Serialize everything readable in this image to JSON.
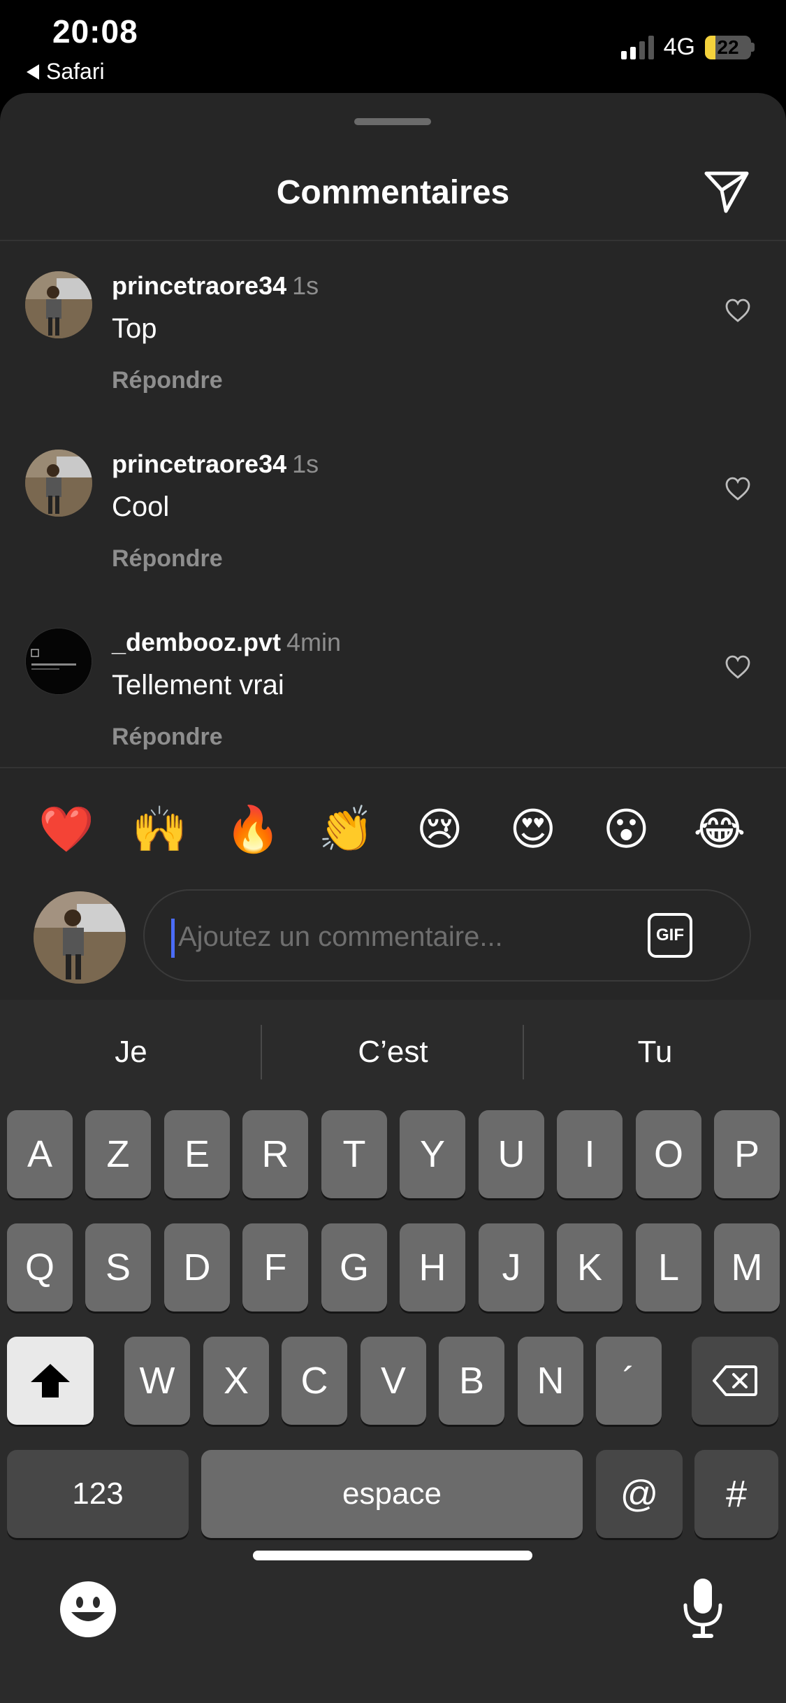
{
  "status": {
    "time": "20:08",
    "back_app": "Safari",
    "network": "4G",
    "battery": "22"
  },
  "sheet": {
    "title": "Commentaires"
  },
  "comments": [
    {
      "username": "princetraore34",
      "time": "1s",
      "text": "Top",
      "reply": "Répondre"
    },
    {
      "username": "princetraore34",
      "time": "1s",
      "text": "Cool",
      "reply": "Répondre"
    },
    {
      "username": "_dembooz.pvt",
      "time": "4min",
      "text": "Tellement vrai",
      "reply": "Répondre"
    }
  ],
  "reactions": [
    "❤️",
    "🙌",
    "🔥",
    "👏",
    "😢",
    "😍",
    "😮",
    "😂"
  ],
  "input": {
    "placeholder": "Ajoutez un commentaire...",
    "gif_label": "GIF"
  },
  "keyboard": {
    "suggestions": [
      "Je",
      "C’est",
      "Tu"
    ],
    "row1": [
      "A",
      "Z",
      "E",
      "R",
      "T",
      "Y",
      "U",
      "I",
      "O",
      "P"
    ],
    "row2": [
      "Q",
      "S",
      "D",
      "F",
      "G",
      "H",
      "J",
      "K",
      "L",
      "M"
    ],
    "row3": [
      "W",
      "X",
      "C",
      "V",
      "B",
      "N",
      "´"
    ],
    "numbers_label": "123",
    "space_label": "espace",
    "at_label": "@",
    "hash_label": "#"
  }
}
